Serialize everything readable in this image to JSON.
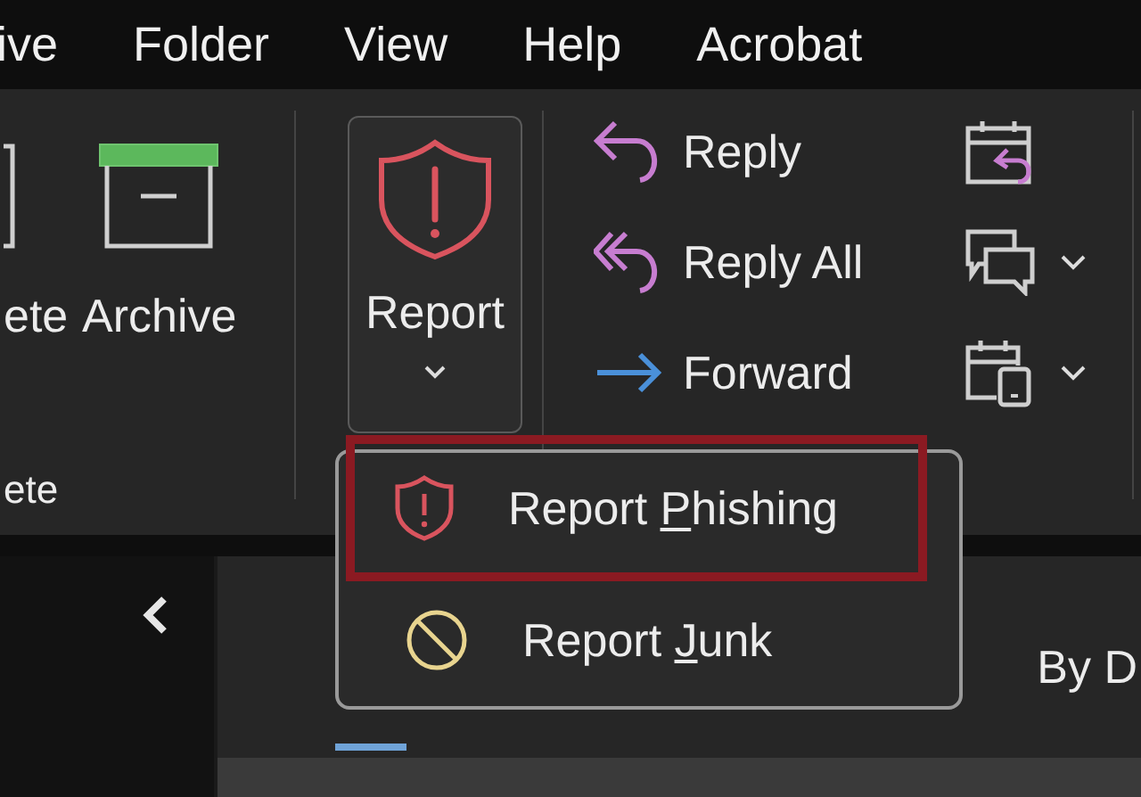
{
  "menu_bar": [
    "ive",
    "Folder",
    "View",
    "Help",
    "Acrobat"
  ],
  "ribbon": {
    "delete_group": {
      "label": "ete",
      "buttons": [
        {
          "kind": "delete",
          "label": "ete"
        },
        {
          "kind": "archive",
          "label": "Archive"
        }
      ]
    },
    "report": {
      "label": "Report",
      "expanded": true
    },
    "respond": [
      {
        "kind": "reply",
        "label": "Reply"
      },
      {
        "kind": "reply_all",
        "label": "Reply All"
      },
      {
        "kind": "forward",
        "label": "Forward"
      }
    ],
    "respond_extra": [
      {
        "kind": "meeting",
        "has_menu": false
      },
      {
        "kind": "chat",
        "has_menu": true
      },
      {
        "kind": "teams",
        "has_menu": true
      }
    ]
  },
  "report_menu": [
    {
      "kind": "phishing",
      "label_start": "Report ",
      "access_key": "P",
      "label_end": "hishing",
      "highlighted": true
    },
    {
      "kind": "junk",
      "label_start": "Report ",
      "access_key": "J",
      "label_end": "unk",
      "highlighted": false
    }
  ],
  "message_list": {
    "sort_label": "By D"
  }
}
